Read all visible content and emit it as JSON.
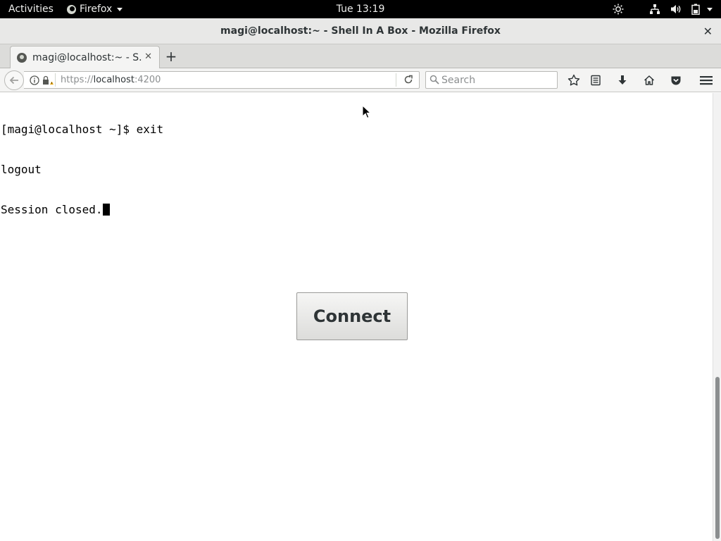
{
  "topbar": {
    "activities": "Activities",
    "app_name": "Firefox",
    "clock": "Tue 13:19"
  },
  "window": {
    "title": "magi@localhost:~ - Shell In A Box - Mozilla Firefox"
  },
  "tabs": [
    {
      "label": "magi@localhost:~ - S..."
    }
  ],
  "navbar": {
    "url_scheme": "https://",
    "url_host": "localhost",
    "url_port": ":4200",
    "search_placeholder": "Search"
  },
  "terminal": {
    "lines": [
      "[magi@localhost ~]$ exit",
      "logout",
      "Session closed."
    ]
  },
  "connect_label": "Connect"
}
